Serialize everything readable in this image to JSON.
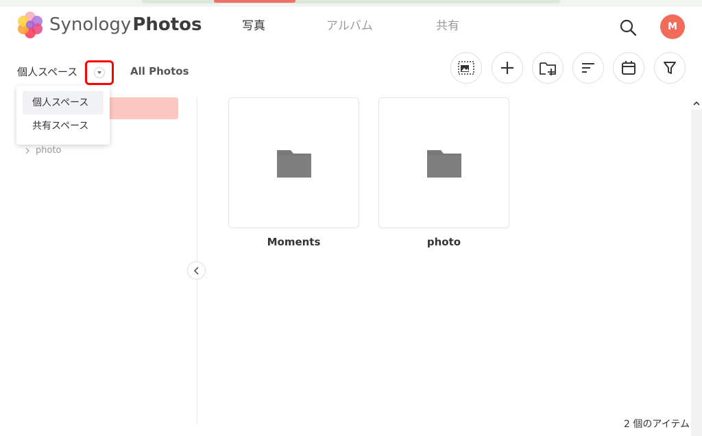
{
  "brand": {
    "light": "Synology",
    "bold": "Photos"
  },
  "tabs": [
    {
      "label": "写真",
      "active": true
    },
    {
      "label": "アルバム",
      "active": false
    },
    {
      "label": "共有",
      "active": false
    }
  ],
  "user": {
    "initial": "M",
    "color": "#f26a5a"
  },
  "space": {
    "current": "個人スペース",
    "view_label": "All Photos"
  },
  "dropdown": {
    "options": [
      "個人スペース",
      "共有スペース"
    ],
    "selected": "個人スペース"
  },
  "tree": {
    "items": [
      "photo"
    ]
  },
  "toolbar": {
    "icons": [
      "select-mode-icon",
      "add-icon",
      "new-folder-icon",
      "sort-icon",
      "calendar-icon",
      "filter-icon"
    ]
  },
  "folders": [
    {
      "name": "Moments"
    },
    {
      "name": "photo"
    }
  ],
  "footer": {
    "item_count": "2 個のアイテム"
  },
  "colors": {
    "accent": "#f07067",
    "selected_bg": "#fcc6c1",
    "highlight_box": "#ff0000"
  }
}
